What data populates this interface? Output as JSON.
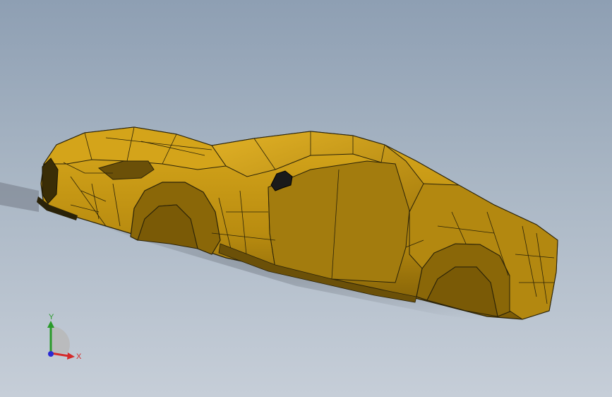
{
  "viewport": {
    "model_icon": "car-body-surface-model",
    "colors": {
      "body": "#c99a12",
      "body_dark": "#8a6708",
      "edge": "#2a2208",
      "background_top": "#8e9fb3",
      "background_bottom": "#c6ced8"
    }
  },
  "triad": {
    "x_label": "X",
    "y_label": "Y",
    "colors": {
      "x": "#d42a2a",
      "y": "#2a9a2a",
      "z": "#2a2ad4"
    }
  }
}
